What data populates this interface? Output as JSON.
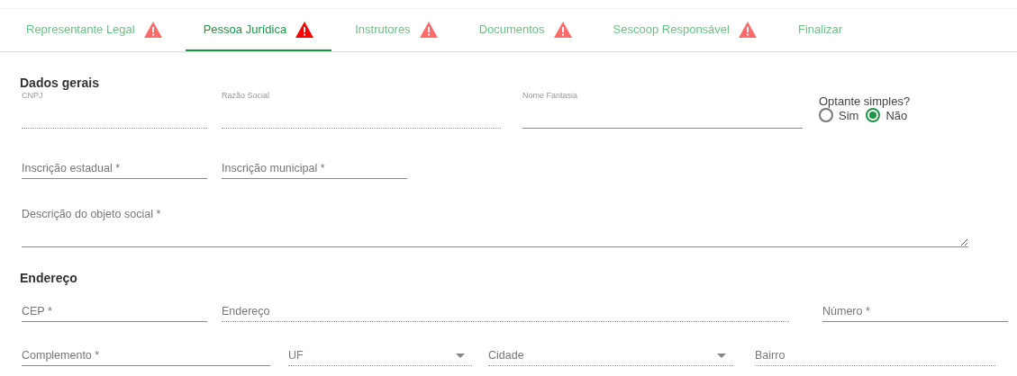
{
  "tabs": [
    {
      "label": "Representante Legal",
      "selected": false,
      "warning": true
    },
    {
      "label": "Pessoa Jurídica",
      "selected": true,
      "warning": true
    },
    {
      "label": "Instrutores",
      "selected": false,
      "warning": true
    },
    {
      "label": "Documentos",
      "selected": false,
      "warning": true
    },
    {
      "label": "Sescoop Responsável",
      "selected": false,
      "warning": true
    },
    {
      "label": "Finalizar",
      "selected": false,
      "warning": false
    }
  ],
  "sections": [
    {
      "title": "Dados gerais",
      "rows": [
        [
          {
            "kind": "text",
            "label": "CNPJ",
            "disabled": true
          },
          {
            "kind": "text",
            "label": "Razão Social",
            "disabled": true
          },
          {
            "kind": "text",
            "label": "Nome Fantasia",
            "disabled": false
          },
          {
            "kind": "radio",
            "label": "Optante simples?",
            "options": [
              {
                "label": "Sim",
                "selected": false
              },
              {
                "label": "Não",
                "selected": true
              }
            ]
          }
        ],
        [
          {
            "kind": "text",
            "placeholder": "Inscrição estadual *",
            "disabled": false
          },
          {
            "kind": "text",
            "placeholder": "Inscrição municipal *",
            "disabled": false
          }
        ],
        [
          {
            "kind": "textarea",
            "placeholder": "Descrição do objeto social *",
            "disabled": false
          }
        ]
      ]
    },
    {
      "title": "Endereço",
      "rows": [
        [
          {
            "kind": "text",
            "placeholder": "CEP *",
            "disabled": false
          },
          {
            "kind": "text",
            "placeholder": "Endereço",
            "disabled": true
          },
          {
            "kind": "text",
            "placeholder": "Número *",
            "disabled": false
          }
        ],
        [
          {
            "kind": "text",
            "placeholder": "Complemento *",
            "disabled": false
          },
          {
            "kind": "select",
            "placeholder": "UF",
            "disabled": true
          },
          {
            "kind": "select",
            "placeholder": "Cidade",
            "disabled": true
          },
          {
            "kind": "text",
            "placeholder": "Bairro",
            "disabled": true
          }
        ]
      ]
    }
  ]
}
